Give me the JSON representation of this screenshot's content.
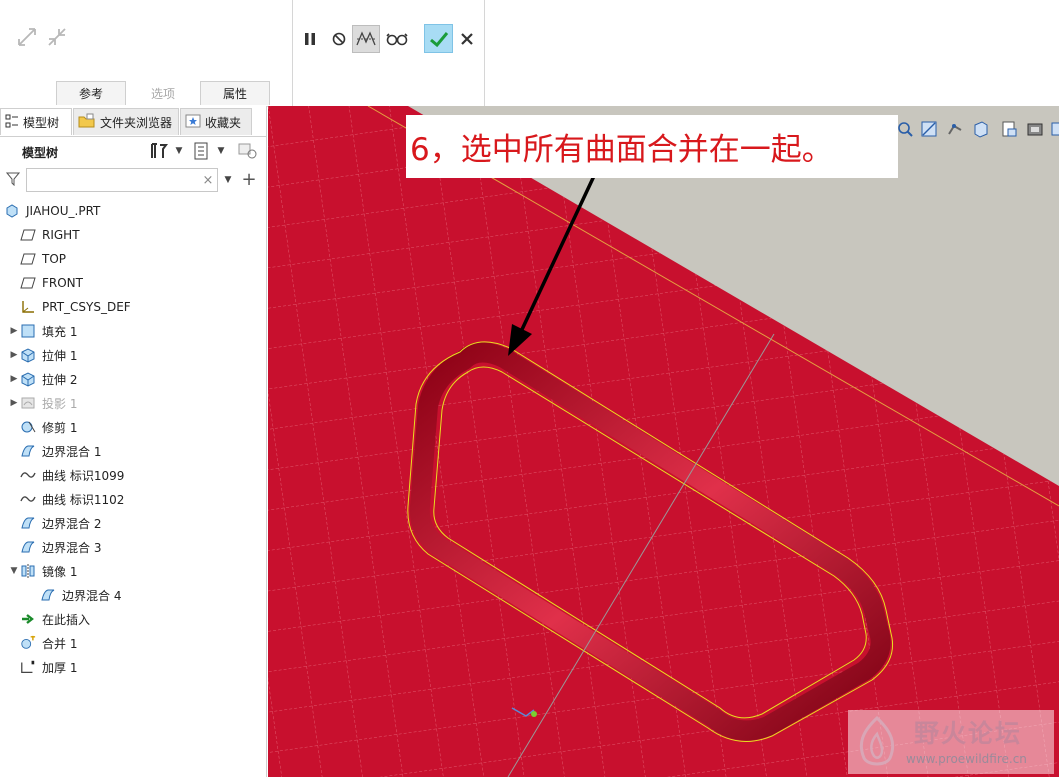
{
  "dashboard": {
    "tabs": [
      {
        "label": "参考",
        "state": "normal"
      },
      {
        "label": "选项",
        "state": "disabled"
      },
      {
        "label": "属性",
        "state": "normal"
      }
    ],
    "tool_icons": [
      "maximize-icon",
      "minimize-icon",
      "pause-icon",
      "no-preview-icon",
      "verify-geometry-icon",
      "glasses-preview-icon",
      "ok-checkmark-icon",
      "cancel-x-icon"
    ],
    "colors": {
      "ok_bg": "#a8dcf4",
      "ok_check": "#1a9c3a"
    }
  },
  "navigator": {
    "tabs": [
      {
        "label": "模型树",
        "icon": "model-tree-icon"
      },
      {
        "label": "文件夹浏览器",
        "icon": "folder-browser-icon"
      },
      {
        "label": "收藏夹",
        "icon": "favorites-icon"
      }
    ],
    "tree_title": "模型树",
    "filter_placeholder": "",
    "items": [
      {
        "label": "JIAHOU_.PRT",
        "icon": "part-icon",
        "indent": 0,
        "expander": ""
      },
      {
        "label": "RIGHT",
        "icon": "datum-plane-icon",
        "indent": 1,
        "expander": ""
      },
      {
        "label": "TOP",
        "icon": "datum-plane-icon",
        "indent": 1,
        "expander": ""
      },
      {
        "label": "FRONT",
        "icon": "datum-plane-icon",
        "indent": 1,
        "expander": ""
      },
      {
        "label": "PRT_CSYS_DEF",
        "icon": "coordinate-system-icon",
        "indent": 1,
        "expander": ""
      },
      {
        "label": "填充 1",
        "icon": "fill-icon",
        "indent": 1,
        "expander": "▶"
      },
      {
        "label": "拉伸 1",
        "icon": "extrude-icon",
        "indent": 1,
        "expander": "▶"
      },
      {
        "label": "拉伸 2",
        "icon": "extrude-icon",
        "indent": 1,
        "expander": "▶"
      },
      {
        "label": "投影 1",
        "icon": "project-icon",
        "indent": 1,
        "expander": "▶",
        "dim": true
      },
      {
        "label": "修剪 1",
        "icon": "trim-icon",
        "indent": 1,
        "expander": ""
      },
      {
        "label": "边界混合 1",
        "icon": "boundary-blend-icon",
        "indent": 1,
        "expander": ""
      },
      {
        "label": "曲线 标识1099",
        "icon": "curve-icon",
        "indent": 1,
        "expander": ""
      },
      {
        "label": "曲线 标识1102",
        "icon": "curve-icon",
        "indent": 1,
        "expander": ""
      },
      {
        "label": "边界混合 2",
        "icon": "boundary-blend-icon",
        "indent": 1,
        "expander": ""
      },
      {
        "label": "边界混合 3",
        "icon": "boundary-blend-icon",
        "indent": 1,
        "expander": ""
      },
      {
        "label": "镜像 1",
        "icon": "mirror-icon",
        "indent": 1,
        "expander": "▼"
      },
      {
        "label": "边界混合 4",
        "icon": "boundary-blend-icon",
        "indent": 2,
        "expander": ""
      },
      {
        "label": "在此插入",
        "icon": "insert-here-arrow-icon",
        "indent": 1,
        "expander": ""
      },
      {
        "label": "合并 1",
        "icon": "merge-icon",
        "indent": 1,
        "expander": ""
      },
      {
        "label": "加厚 1",
        "icon": "thicken-icon",
        "indent": 1,
        "expander": ""
      }
    ]
  },
  "graphics": {
    "annotation": "6，选中所有曲面合并在一起。",
    "colors": {
      "surface": "#c8102e",
      "grid": "#e25a6e",
      "highlight_edge": "#e8e020",
      "background": "#c8c6be"
    }
  },
  "watermark": {
    "title": "野火论坛",
    "url": "www.proewildfire.cn"
  }
}
